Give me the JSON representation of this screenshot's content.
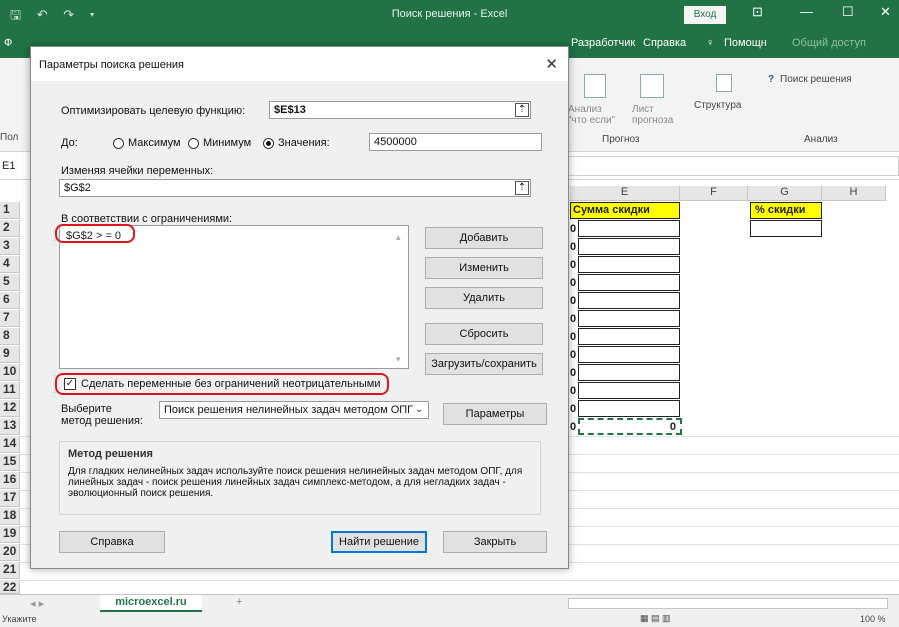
{
  "window": {
    "title": "Поиск решения  -  Excel",
    "login": "Вход"
  },
  "ribbon": {
    "tabs_visible": [
      "Ф",
      "Разработчик",
      "Справка",
      "Помощн",
      "Общий доступ"
    ],
    "groups": {
      "forecast": {
        "label": "Прогноз",
        "btn1": "Анализ \"что если\"",
        "btn2": "Лист прогноза"
      },
      "structure": {
        "label": "Структура"
      },
      "analysis": {
        "label": "Анализ",
        "solver": "Поиск решения"
      }
    },
    "left_cut_label": "Пол"
  },
  "formula_bar": {
    "name_box": "E1"
  },
  "sheet": {
    "columns": [
      "E",
      "F",
      "G",
      "H"
    ],
    "rows": [
      "1",
      "2",
      "3",
      "4",
      "5",
      "6",
      "7",
      "8",
      "9",
      "10",
      "11",
      "12",
      "13",
      "14",
      "15",
      "16",
      "17",
      "18",
      "19",
      "20",
      "21",
      "22"
    ],
    "header_discount_sum": "Сумма скидки",
    "header_discount_pct": "% скидки",
    "total_value": "0",
    "cut_values": [
      "0",
      "0",
      "0",
      "0",
      "0",
      "0",
      "0",
      "0",
      "0",
      "0",
      "0",
      "0"
    ],
    "yellow": "#ffff00",
    "green": "#217346"
  },
  "sheet_tabs": {
    "active": "microexcel.ru",
    "add": "+"
  },
  "status": {
    "left": "Укажите",
    "zoom": "100 %"
  },
  "dialog": {
    "title": "Параметры поиска решения",
    "objective_label": "Оптимизировать целевую функцию:",
    "objective_value": "$E$13",
    "to_label": "До:",
    "radio_max": "Максимум",
    "radio_min": "Минимум",
    "radio_value": "Значения:",
    "value_of": "4500000",
    "changing_label": "Изменяя ячейки переменных:",
    "changing_value": "$G$2",
    "constraints_label": "В соответствии с ограничениями:",
    "constraints": [
      "$G$2 > = 0"
    ],
    "btn_add": "Добавить",
    "btn_change": "Изменить",
    "btn_delete": "Удалить",
    "btn_reset": "Сбросить",
    "btn_loadsave": "Загрузить/сохранить",
    "nonneg_label": "Сделать переменные без ограничений неотрицательными",
    "method_label_1": "Выберите",
    "method_label_2": "метод решения:",
    "method_value": "Поиск решения нелинейных задач методом ОПГ",
    "btn_params": "Параметры",
    "method_group_title": "Метод решения",
    "method_desc": "Для гладких нелинейных задач используйте поиск решения нелинейных задач методом ОПГ, для линейных задач - поиск решения линейных задач симплекс-методом, а для негладких задач - эволюционный поиск решения.",
    "btn_help": "Справка",
    "btn_solve": "Найти решение",
    "btn_close": "Закрыть",
    "highlight_color": "#e0141e"
  }
}
